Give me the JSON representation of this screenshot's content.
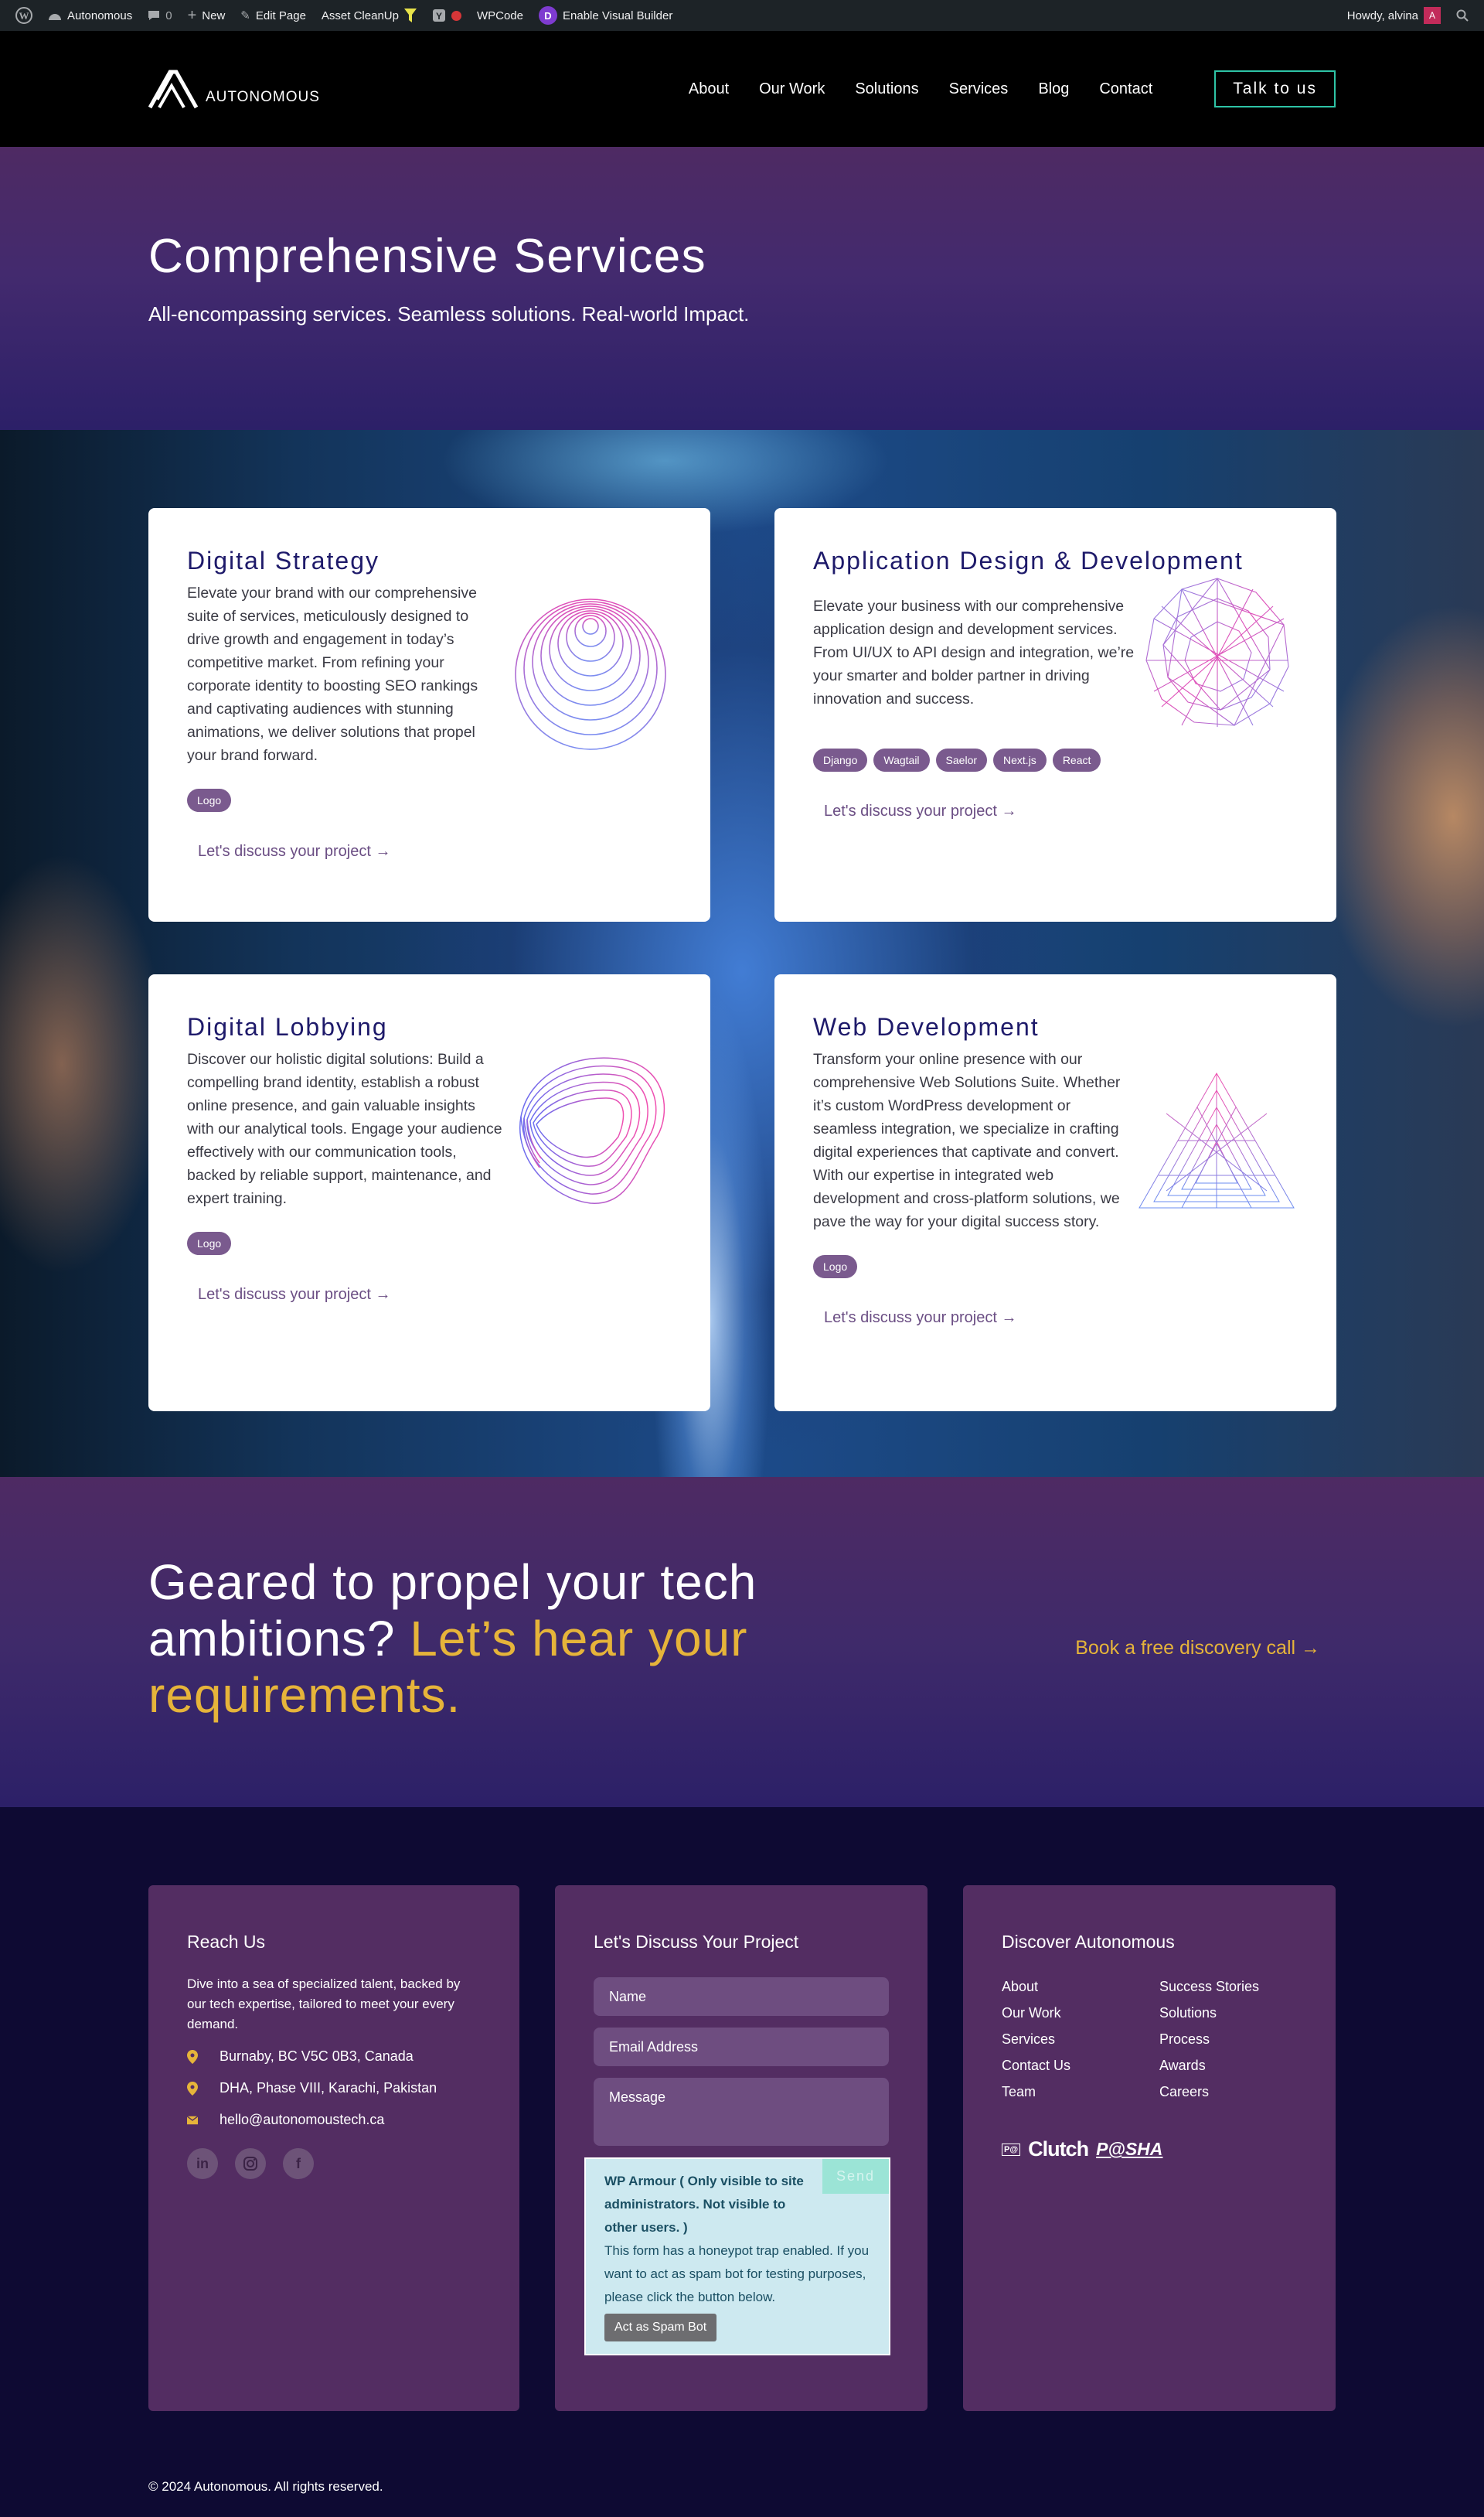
{
  "admin_bar": {
    "site": "Autonomous",
    "comments": "0",
    "new": "New",
    "edit": "Edit Page",
    "asset": "Asset CleanUp",
    "wpcode": "WPCode",
    "visual": "Enable Visual Builder",
    "howdy": "Howdy, alvina"
  },
  "header": {
    "logo_text": "AUTONOMOUS",
    "nav": [
      "About",
      "Our Work",
      "Solutions",
      "Services",
      "Blog",
      "Contact"
    ],
    "cta": "Talk to us"
  },
  "hero": {
    "title": "Comprehensive Services",
    "subtitle": "All-encompassing services. Seamless solutions. Real-world Impact."
  },
  "services": [
    {
      "title": "Digital Strategy",
      "desc": "Elevate your brand with our comprehensive suite of services, meticulously designed to drive growth and engagement in today’s competitive market. From refining your corporate identity to boosting SEO rankings and captivating audiences with stunning animations, we deliver solutions that propel your brand forward.",
      "tags": [
        "Logo"
      ],
      "link": "Let's discuss your project →"
    },
    {
      "title": "Application Design & Development",
      "desc": "Elevate your business with our comprehensive application design and development services. From UI/UX to API design and integration, we’re your smarter and bolder partner in driving innovation and success.",
      "tags": [
        "Django",
        "Wagtail",
        "Saelor",
        "Next.js",
        "React"
      ],
      "link": "Let's discuss your project →"
    },
    {
      "title": "Digital Lobbying",
      "desc": "Discover our holistic digital solutions: Build a compelling brand identity, establish a robust online presence, and gain valuable insights with our analytical tools. Engage your audience effectively with our communication tools, backed by reliable support, maintenance, and expert training.",
      "tags": [
        "Logo"
      ],
      "link": "Let's discuss your project →"
    },
    {
      "title": "Web Development",
      "desc": "Transform your online presence with our comprehensive Web Solutions Suite. Whether it’s custom WordPress development or seamless integration, we specialize in crafting digital experiences that captivate and convert. With our expertise in integrated web development and cross-platform solutions, we pave the way for your digital success story.",
      "tags": [
        "Logo"
      ],
      "link": "Let's discuss your project →"
    }
  ],
  "cta": {
    "line1": "Geared to propel your tech ambitions? ",
    "highlight": "Let’s hear your requirements.",
    "link": "Book a free discovery call →"
  },
  "footer": {
    "reach": {
      "title": "Reach Us",
      "text": "Dive into a sea of specialized talent, backed by our tech expertise, tailored to meet your every demand.",
      "addr1": "Burnaby, BC V5C 0B3, Canada",
      "addr2": "DHA, Phase VIII, Karachi, Pakistan",
      "email": "hello@autonomoustech.ca"
    },
    "form": {
      "title": "Let's Discuss Your Project",
      "name": "Name",
      "email": "Email Address",
      "message": "Message",
      "wpa_title": "WP Armour ( Only visible to site administrators. Not visible to other users. )",
      "wpa_text": "This form has a honeypot trap enabled. If you want to act as spam bot for testing purposes, please click the button below.",
      "spam": "Act as Spam Bot",
      "send": "Send"
    },
    "discover": {
      "title": "Discover Autonomous",
      "links": [
        "About",
        "Success Stories",
        "Our Work",
        "Solutions",
        "Services",
        "Process",
        "Contact Us",
        "Awards",
        "Team",
        "Careers"
      ],
      "p1": "Clutch",
      "p2": "P@SHA"
    },
    "copyright": "© 2024 Autonomous. All rights reserved."
  }
}
